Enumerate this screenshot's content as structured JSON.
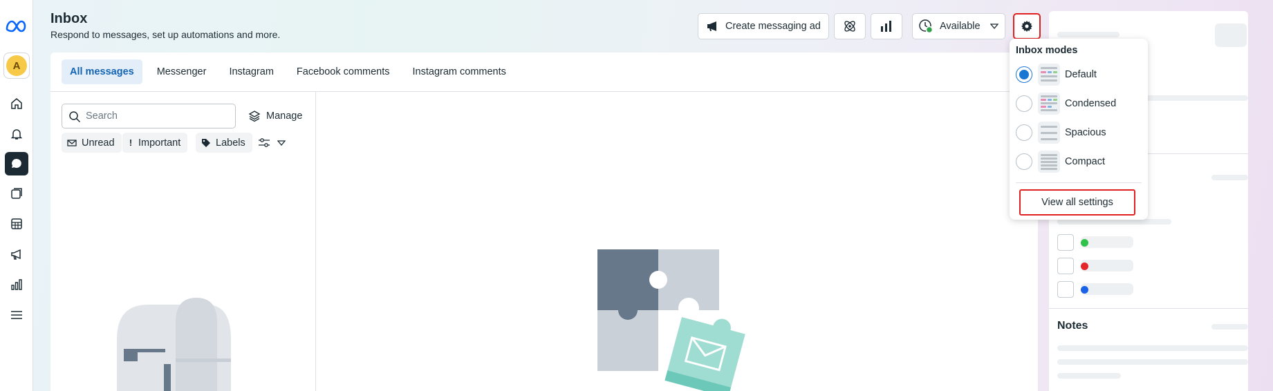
{
  "header": {
    "title": "Inbox",
    "subtitle": "Respond to messages, set up automations and more.",
    "create_ad_label": "Create messaging ad",
    "availability_label": "Available"
  },
  "tabs": [
    {
      "label": "All messages",
      "selected": true
    },
    {
      "label": "Messenger",
      "selected": false
    },
    {
      "label": "Instagram",
      "selected": false
    },
    {
      "label": "Facebook comments",
      "selected": false
    },
    {
      "label": "Instagram comments",
      "selected": false
    }
  ],
  "list": {
    "search_placeholder": "Search",
    "manage_label": "Manage",
    "filters": {
      "unread": "Unread",
      "important": "Important",
      "labels": "Labels"
    }
  },
  "avatar": {
    "initial": "A"
  },
  "inbox_modes": {
    "heading": "Inbox modes",
    "options": [
      {
        "label": "Default",
        "selected": true
      },
      {
        "label": "Condensed",
        "selected": false
      },
      {
        "label": "Spacious",
        "selected": false
      },
      {
        "label": "Compact",
        "selected": false
      }
    ],
    "view_all_label": "View all settings"
  },
  "details": {
    "notes_heading": "Notes"
  },
  "colors": {
    "accent": "#1877d2",
    "highlight": "#e02020",
    "rail_active": "#1c2b33"
  }
}
